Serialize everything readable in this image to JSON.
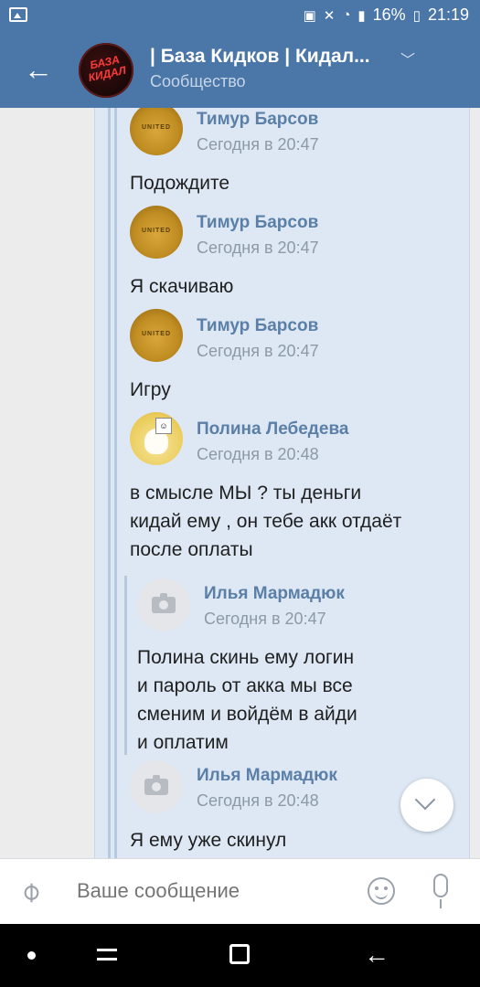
{
  "status_bar": {
    "battery": "16%",
    "time": "21:19"
  },
  "header": {
    "title": "| База Кидков | Кидал...",
    "subtitle": "Сообщество",
    "avatar_text": "БАЗА КИДАЛ"
  },
  "messages": [
    {
      "author": "Тимур Барсов",
      "time": "Сегодня в 20:47",
      "text": [
        "Подождите"
      ]
    },
    {
      "author": "Тимур Барсов",
      "time": "Сегодня в 20:47",
      "text": [
        "Я скачиваю"
      ]
    },
    {
      "author": "Тимур Барсов",
      "time": "Сегодня в 20:47",
      "text": [
        "Игру"
      ]
    },
    {
      "author": "Полина Лебедева",
      "time": "Сегодня в 20:48",
      "text": [
        "в смысле МЫ ? ты деньги",
        "кидай ему , он тебе акк отдаёт",
        "после оплаты"
      ]
    },
    {
      "author": "Илья Мармадюк",
      "time": "Сегодня в 20:47",
      "text": [
        "Полина скинь ему логин",
        "и пароль от акка мы все",
        "сменим и войдём в айди",
        "и оплатим"
      ]
    },
    {
      "author": "Илья Мармадюк",
      "time": "Сегодня в 20:48",
      "text": [
        "Я ему уже скинул"
      ]
    }
  ],
  "composer": {
    "placeholder": "Ваше сообщение"
  },
  "colors": {
    "header": "#4a76a8",
    "name": "#5b7fa6",
    "panel": "#dde8f4"
  }
}
